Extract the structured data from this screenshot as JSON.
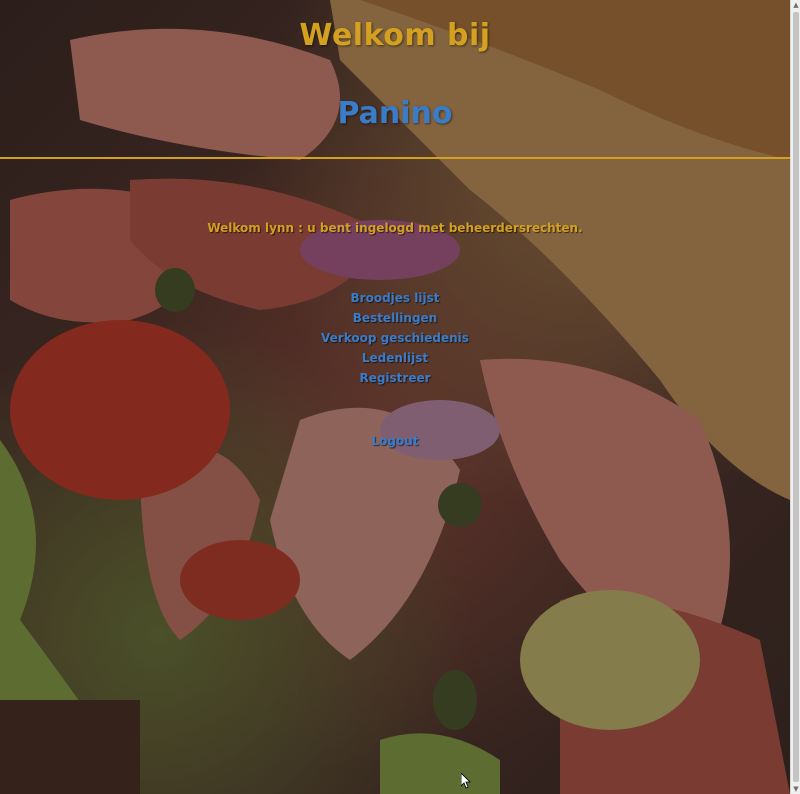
{
  "header": {
    "welcome_title": "Welkom bij",
    "brand_title": "Panino"
  },
  "session": {
    "login_message": "Welkom lynn : u bent ingelogd met beheerdersrechten."
  },
  "nav": {
    "items": [
      {
        "label": "Broodjes lijst"
      },
      {
        "label": "Bestellingen"
      },
      {
        "label": "Verkoop geschiedenis"
      },
      {
        "label": "Ledenlijst"
      },
      {
        "label": "Registreer"
      }
    ],
    "logout_label": "Logout"
  },
  "background": {
    "image_description_icon": "sandwich-photo",
    "dim_overlay": true
  },
  "colors": {
    "gold": "#d4a020",
    "blue": "#3a7cc8",
    "divider": "#d4a020"
  }
}
